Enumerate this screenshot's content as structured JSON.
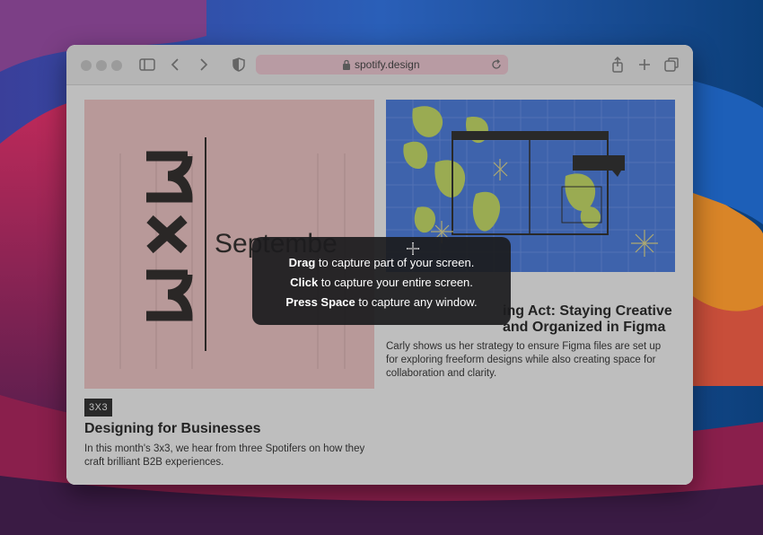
{
  "browser": {
    "url": "spotify.design",
    "icons": [
      "sidebar-icon",
      "back-icon",
      "forward-icon",
      "shield-icon",
      "lock-icon",
      "reload-icon",
      "share-icon",
      "new-tab-icon",
      "tabs-overview-icon"
    ]
  },
  "cards": {
    "left": {
      "badge": "3X3",
      "image_text_big": "3x3",
      "image_text_side": "Septembe",
      "title": "Designing for Businesses",
      "description": "In this month's 3x3, we hear from three Spotifers on how they craft brilliant B2B experiences."
    },
    "right": {
      "title_visible": "ing Act: Staying Creative and Organized in Figma",
      "description": "Carly shows us her strategy to ensure Figma files are set up for exploring freeform designs while also creating space for collaboration and clarity."
    }
  },
  "hud": {
    "line1_bold": "Drag",
    "line1_rest": " to capture part of your screen.",
    "line2_bold": "Click",
    "line2_rest": " to capture your entire screen.",
    "line3_bold": "Press Space",
    "line3_rest": " to capture any window."
  },
  "colors": {
    "url_bar": "#f6c9d6",
    "left_image_bg": "#f6c7c6",
    "right_image_bg": "#3b73e3",
    "hud_bg": "#1c1c1e"
  }
}
